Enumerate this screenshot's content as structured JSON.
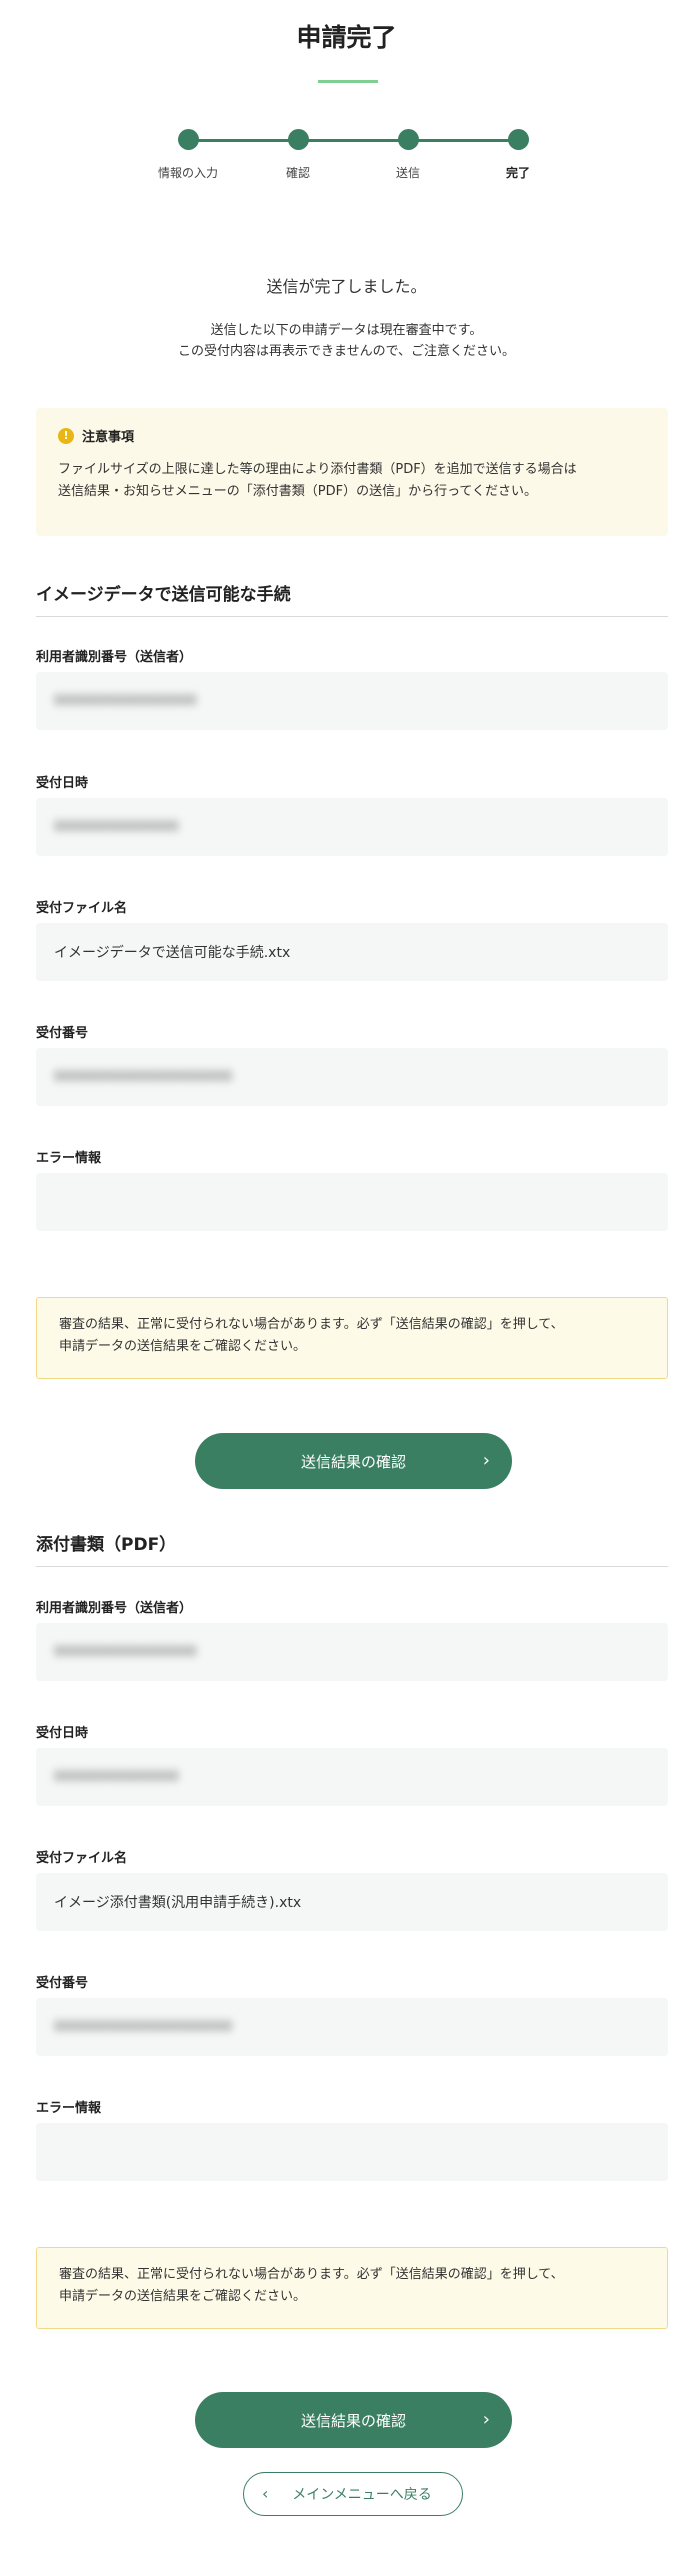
{
  "page": {
    "title": "申請完了"
  },
  "stepper": {
    "steps": [
      "情報の入力",
      "確認",
      "送信",
      "完了"
    ]
  },
  "status": {
    "headline": "送信が完了しました。",
    "line1": "送信した以下の申請データは現在審査中です。",
    "line2": "この受付内容は再表示できませんので、ご注意ください。"
  },
  "notice": {
    "title": "注意事項",
    "line1": "ファイルサイズの上限に達した等の理由により添付書類（PDF）を追加で送信する場合は",
    "line2": "送信結果・お知らせメニューの「添付書類（PDF）の送信」から行ってください。"
  },
  "section_image": {
    "heading": "イメージデータで送信可能な手続",
    "user_id_label": "利用者識別番号（送信者）",
    "user_id_value": "0000000000000000",
    "received_at_label": "受付日時",
    "received_at_value": "00000000000000",
    "file_name_label": "受付ファイル名",
    "file_name_value": "イメージデータで送信可能な手続.xtx",
    "receipt_no_label": "受付番号",
    "receipt_no_value": "00000000000000000000",
    "error_label": "エラー情報",
    "error_value": "",
    "alert_line1": "審査の結果、正常に受付られない場合があります。必ず「送信結果の確認」を押して、",
    "alert_line2": "申請データの送信結果をご確認ください。",
    "button_label": "送信結果の確認"
  },
  "section_pdf": {
    "heading": "添付書類（PDF）",
    "user_id_label": "利用者識別番号（送信者）",
    "user_id_value": "0000000000000000",
    "received_at_label": "受付日時",
    "received_at_value": "00000000000000",
    "file_name_label": "受付ファイル名",
    "file_name_value": "イメージ添付書類(汎用申請手続き).xtx",
    "receipt_no_label": "受付番号",
    "receipt_no_value": "00000000000000000000",
    "error_label": "エラー情報",
    "error_value": "",
    "alert_line1": "審査の結果、正常に受付られない場合があります。必ず「送信結果の確認」を押して、",
    "alert_line2": "申請データの送信結果をご確認ください。",
    "button_label": "送信結果の確認"
  },
  "footer": {
    "back_button_label": "メインメニューへ戻る"
  },
  "colors": {
    "accent": "#3b7f62",
    "accent_light": "#7fcf93",
    "notice_bg": "#fdf9e8",
    "warning": "#e8b716"
  }
}
